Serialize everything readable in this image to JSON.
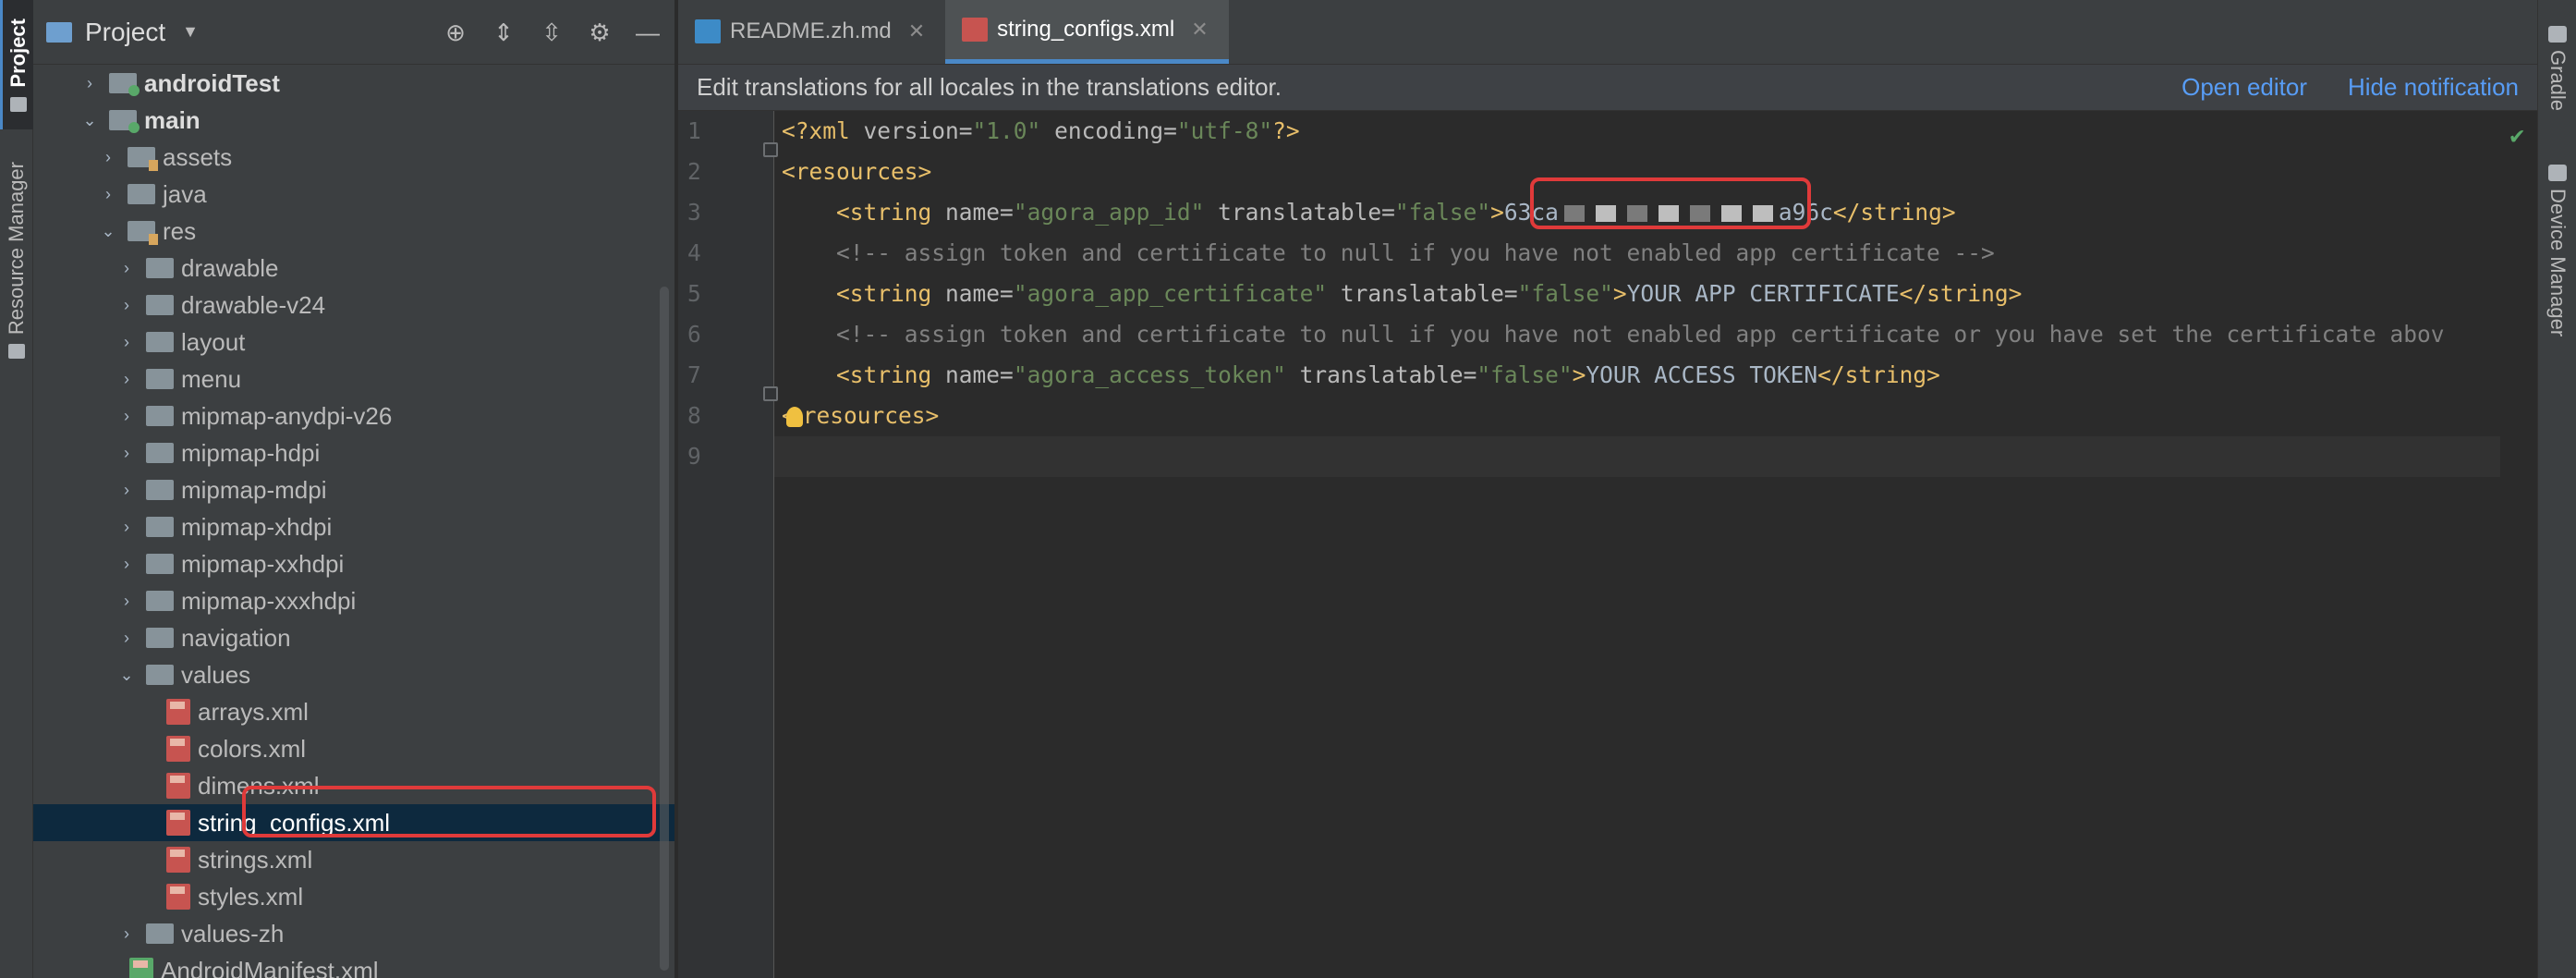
{
  "left_strip": {
    "project_tab": "Project",
    "resource_manager_tab": "Resource Manager"
  },
  "project_panel": {
    "title": "Project",
    "tree": [
      {
        "label": "androidTest",
        "indent": 1,
        "expanded": false,
        "kind": "module-folder",
        "bold": true
      },
      {
        "label": "main",
        "indent": 1,
        "expanded": true,
        "kind": "module-folder",
        "bold": true
      },
      {
        "label": "assets",
        "indent": 2,
        "expanded": false,
        "kind": "res-folder"
      },
      {
        "label": "java",
        "indent": 2,
        "expanded": false,
        "kind": "folder"
      },
      {
        "label": "res",
        "indent": 2,
        "expanded": true,
        "kind": "res-folder"
      },
      {
        "label": "drawable",
        "indent": 3,
        "expanded": false,
        "kind": "folder"
      },
      {
        "label": "drawable-v24",
        "indent": 3,
        "expanded": false,
        "kind": "folder"
      },
      {
        "label": "layout",
        "indent": 3,
        "expanded": false,
        "kind": "folder"
      },
      {
        "label": "menu",
        "indent": 3,
        "expanded": false,
        "kind": "folder"
      },
      {
        "label": "mipmap-anydpi-v26",
        "indent": 3,
        "expanded": false,
        "kind": "folder"
      },
      {
        "label": "mipmap-hdpi",
        "indent": 3,
        "expanded": false,
        "kind": "folder"
      },
      {
        "label": "mipmap-mdpi",
        "indent": 3,
        "expanded": false,
        "kind": "folder"
      },
      {
        "label": "mipmap-xhdpi",
        "indent": 3,
        "expanded": false,
        "kind": "folder"
      },
      {
        "label": "mipmap-xxhdpi",
        "indent": 3,
        "expanded": false,
        "kind": "folder"
      },
      {
        "label": "mipmap-xxxhdpi",
        "indent": 3,
        "expanded": false,
        "kind": "folder"
      },
      {
        "label": "navigation",
        "indent": 3,
        "expanded": false,
        "kind": "folder"
      },
      {
        "label": "values",
        "indent": 3,
        "expanded": true,
        "kind": "folder"
      },
      {
        "label": "arrays.xml",
        "indent": 4,
        "kind": "xml-file"
      },
      {
        "label": "colors.xml",
        "indent": 4,
        "kind": "xml-file"
      },
      {
        "label": "dimens.xml",
        "indent": 4,
        "kind": "xml-file"
      },
      {
        "label": "string_configs.xml",
        "indent": 4,
        "kind": "xml-file",
        "selected": true
      },
      {
        "label": "strings.xml",
        "indent": 4,
        "kind": "xml-file"
      },
      {
        "label": "styles.xml",
        "indent": 4,
        "kind": "xml-file"
      },
      {
        "label": "values-zh",
        "indent": 3,
        "expanded": false,
        "kind": "folder"
      },
      {
        "label": "AndroidManifest.xml",
        "indent": 2,
        "kind": "manifest-file"
      }
    ]
  },
  "editor": {
    "tabs": [
      {
        "label": "README.zh.md",
        "icon": "markdown-file-icon",
        "active": false
      },
      {
        "label": "string_configs.xml",
        "icon": "xml-file-icon",
        "active": true
      }
    ],
    "notification": {
      "text": "Edit translations for all locales in the translations editor.",
      "open_editor": "Open editor",
      "hide_notification": "Hide notification"
    },
    "line_numbers": [
      "1",
      "2",
      "3",
      "4",
      "5",
      "6",
      "7",
      "8",
      "9"
    ],
    "code": {
      "l1": {
        "decl_open": "<?xml ",
        "a1": "version",
        "eq1": "=",
        "v1": "\"1.0\"",
        "a2": " encoding",
        "eq2": "=",
        "v2": "\"utf-8\"",
        "decl_close": "?>"
      },
      "l2": {
        "tag": "<resources>"
      },
      "l3": {
        "tag_open": "<string ",
        "a1": "name",
        "eq1": "=",
        "v1": "\"agora_app_id\"",
        "a2": " translatable",
        "eq2": "=",
        "v2": "\"false\"",
        "gt": ">",
        "text_start": "63ca",
        "text_end": "a96c",
        "tag_close": "</string>"
      },
      "l4": {
        "comment": "<!-- assign token and certificate to null if you have not enabled app certificate -->"
      },
      "l5": {
        "tag_open": "<string ",
        "a1": "name",
        "eq1": "=",
        "v1": "\"agora_app_certificate\"",
        "a2": " translatable",
        "eq2": "=",
        "v2": "\"false\"",
        "gt": ">",
        "text": "YOUR APP CERTIFICATE",
        "tag_close": "</string>"
      },
      "l6": {
        "comment": "<!-- assign token and certificate to null if you have not enabled app certificate or you have set the certificate abov"
      },
      "l7": {
        "tag_open": "<string ",
        "a1": "name",
        "eq1": "=",
        "v1": "\"agora_access_token\"",
        "a2": " translatable",
        "eq2": "=",
        "v2": "\"false\"",
        "gt": ">",
        "text": "YOUR ACCESS TOKEN",
        "tag_close": "</string>"
      },
      "l8": {
        "tag_a": "<",
        "tag_b": "resources>"
      }
    }
  },
  "right_strip": {
    "gradle_tab": "Gradle",
    "device_manager_tab": "Device Manager"
  },
  "colors": {
    "highlight_box": "#e03a3a",
    "accent": "#4a88c7",
    "link": "#589df6"
  }
}
